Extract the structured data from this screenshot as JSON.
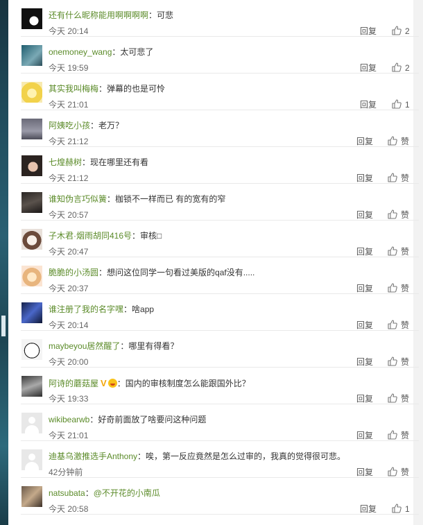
{
  "comments": [
    {
      "user": "还有什么昵称能用啊啊啊啊",
      "text": "：可悲",
      "time": "今天 20:14",
      "reply": "回复",
      "likes": "2",
      "avatar": "bw"
    },
    {
      "user": "onemoney_wang",
      "text": "：太可悲了",
      "time": "今天 19:59",
      "reply": "回复",
      "likes": "2",
      "avatar": "teal"
    },
    {
      "user": "其实我叫梅梅",
      "text": "：弹幕的也是可怜",
      "time": "今天 21:01",
      "reply": "回复",
      "likes": "1",
      "avatar": "yellow"
    },
    {
      "user": "阿姨吃小孩",
      "text": "：老万？",
      "time": "今天 21:12",
      "reply": "回复",
      "likes": "赞",
      "avatar": "gray"
    },
    {
      "user": "七煌赫树",
      "text": "：现在哪里还有看",
      "time": "今天 21:12",
      "reply": "回复",
      "likes": "赞",
      "avatar": "face"
    },
    {
      "user": "谁知伪言巧似簧",
      "text": "：枷锁不一样而已 有的宽有的窄",
      "time": "今天 20:57",
      "reply": "回复",
      "likes": "赞",
      "avatar": "dark"
    },
    {
      "user": "子木君·烟雨胡同416号",
      "text": "：审核□",
      "time": "今天 20:47",
      "reply": "回复",
      "likes": "赞",
      "avatar": "anime"
    },
    {
      "user": "脆脆的小汤圆",
      "text": "：想问这位同学一句看过美版的qaf没有.....",
      "time": "今天 20:37",
      "reply": "回复",
      "likes": "赞",
      "avatar": "peach"
    },
    {
      "user": "谁注册了我的名字嘿",
      "text": "：啥app",
      "time": "今天 20:14",
      "reply": "回复",
      "likes": "赞",
      "avatar": "night"
    },
    {
      "user": "maybeyou居然醒了",
      "text": "：哪里有得看？",
      "time": "今天 20:00",
      "reply": "回复",
      "likes": "赞",
      "avatar": "bear"
    },
    {
      "user": "阿诗的蘑菇屋",
      "text": "：国内的审核制度怎么能跟国外比？",
      "time": "今天 19:33",
      "reply": "回复",
      "likes": "赞",
      "avatar": "girl",
      "badges": true
    },
    {
      "user": "wikibearwb",
      "text": "：好奇前面放了啥要问这种问题",
      "time": "今天 21:01",
      "reply": "回复",
      "likes": "赞",
      "avatar": "default"
    },
    {
      "user": "迪基乌激推选手Anthony",
      "text": "：唉，第一反应竟然是怎么过审的，我真的觉得很可悲。",
      "time": "42分钟前",
      "reply": "回复",
      "likes": "赞",
      "avatar": "default"
    },
    {
      "user": "natsubata",
      "text": "：",
      "mention": "@不开花的小南瓜",
      "time": "今天 20:58",
      "reply": "回复",
      "likes": "1",
      "avatar": "cat"
    }
  ]
}
